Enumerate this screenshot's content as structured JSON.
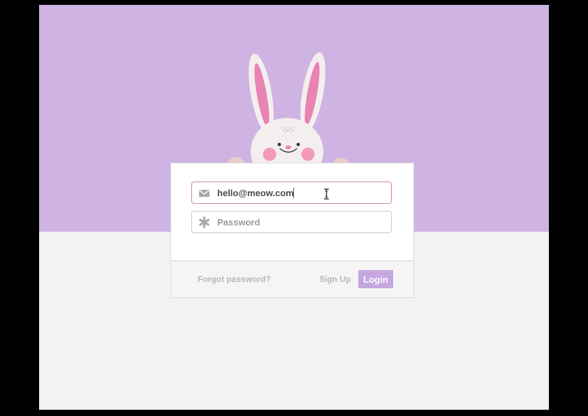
{
  "login_form": {
    "email": {
      "value": "hello@meow.com",
      "icon": "envelope-icon"
    },
    "password": {
      "value": "",
      "placeholder": "Password",
      "icon": "asterisk-icon"
    },
    "forgot_password_label": "Forgot password?",
    "sign_up_label": "Sign Up",
    "login_label": "Login"
  },
  "colors": {
    "background_band": "#ceb3e3",
    "page_background": "#f2f2f2",
    "login_button": "#c6a6e0",
    "active_field_border": "#d08aa0",
    "bunny_inner_ear": "#e983b2",
    "bunny_cheek": "#f19ab9"
  }
}
